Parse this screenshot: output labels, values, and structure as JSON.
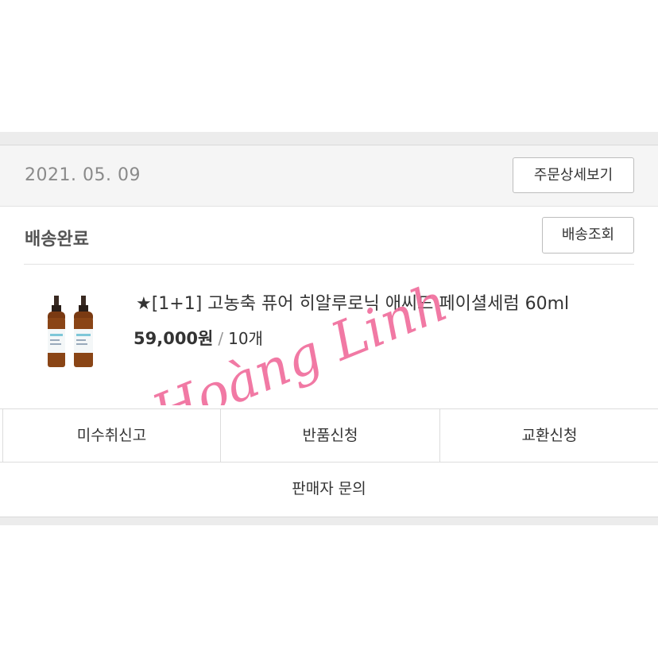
{
  "order": {
    "date": "2021. 05. 09",
    "detail_button": "주문상세보기",
    "status": "배송완료",
    "track_button": "배송조회"
  },
  "product": {
    "name": "★[1+1] 고농축 퓨어 히알루로닉 애씨드 페이셜세럼 60ml",
    "price": "59,000원",
    "separator": "/",
    "quantity": "10개"
  },
  "actions": {
    "not_received": "미수취신고",
    "return": "반품신청",
    "exchange": "교환신청",
    "seller_inquiry": "판매자 문의"
  },
  "watermark": {
    "text": "Hoàng Linh",
    "color": "#f06a9a"
  }
}
